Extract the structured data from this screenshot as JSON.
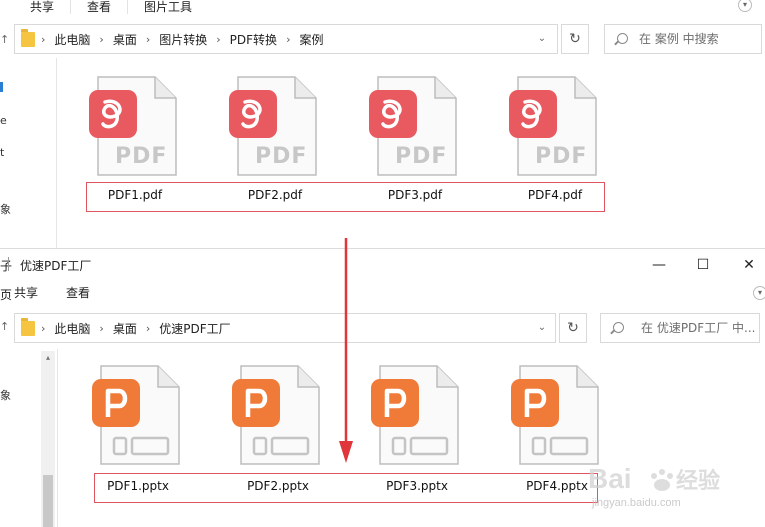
{
  "window1": {
    "ribbon_tabs": [
      "共享",
      "查看",
      "图片工具"
    ],
    "breadcrumb": [
      "此电脑",
      "桌面",
      "图片转换",
      "PDF转换",
      "案例"
    ],
    "search_placeholder": "在 案例 中搜索",
    "nav_fragments": [
      "e",
      "t",
      "象"
    ],
    "files": [
      {
        "label": "PDF",
        "name": "PDF1.pdf"
      },
      {
        "label": "PDF",
        "name": "PDF2.pdf"
      },
      {
        "label": "PDF",
        "name": "PDF3.pdf"
      },
      {
        "label": "PDF",
        "name": "PDF4.pdf"
      }
    ],
    "badge_color": "#e85a5f"
  },
  "window2": {
    "title": "优速PDF工厂",
    "title_left_fragment": "子",
    "ribbon_tabs": [
      "共享",
      "查看"
    ],
    "ribbon_left_fragment": "页",
    "breadcrumb": [
      "此电脑",
      "桌面",
      "优速PDF工厂"
    ],
    "search_placeholder": "在 优速PDF工厂 中...",
    "nav_fragments": [
      "象"
    ],
    "files": [
      {
        "name": "PDF1.pptx"
      },
      {
        "name": "PDF2.pptx"
      },
      {
        "name": "PDF3.pptx"
      },
      {
        "name": "PDF4.pptx"
      }
    ],
    "badge_color": "#f07a38"
  },
  "annotation_color": "#e0353b",
  "watermark": {
    "text": "Bai 经验",
    "sub": "jingyan.baidu.com"
  }
}
